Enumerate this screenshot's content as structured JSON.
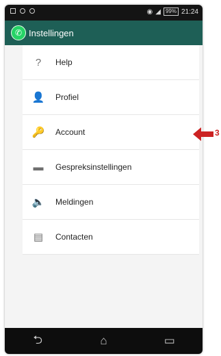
{
  "status_bar": {
    "time": "21:24",
    "battery": "99%"
  },
  "app_bar": {
    "title": "Instellingen"
  },
  "menu": {
    "items": [
      {
        "label": "Help",
        "icon": "help-icon",
        "glyph": "?"
      },
      {
        "label": "Profiel",
        "icon": "profile-icon",
        "glyph": "👤"
      },
      {
        "label": "Account",
        "icon": "key-icon",
        "glyph": "🔑"
      },
      {
        "label": "Gespreksinstellingen",
        "icon": "chat-settings-icon",
        "glyph": "▬"
      },
      {
        "label": "Meldingen",
        "icon": "speaker-icon",
        "glyph": "🔈"
      },
      {
        "label": "Contacten",
        "icon": "contacts-icon",
        "glyph": "▤"
      }
    ]
  },
  "annotation": {
    "step": "3",
    "color": "#cc2222"
  },
  "nav": {
    "back": "⮌",
    "home": "⌂",
    "recents": "▭"
  },
  "colors": {
    "app_bar": "#1e5f56",
    "whatsapp_green": "#25d366"
  }
}
